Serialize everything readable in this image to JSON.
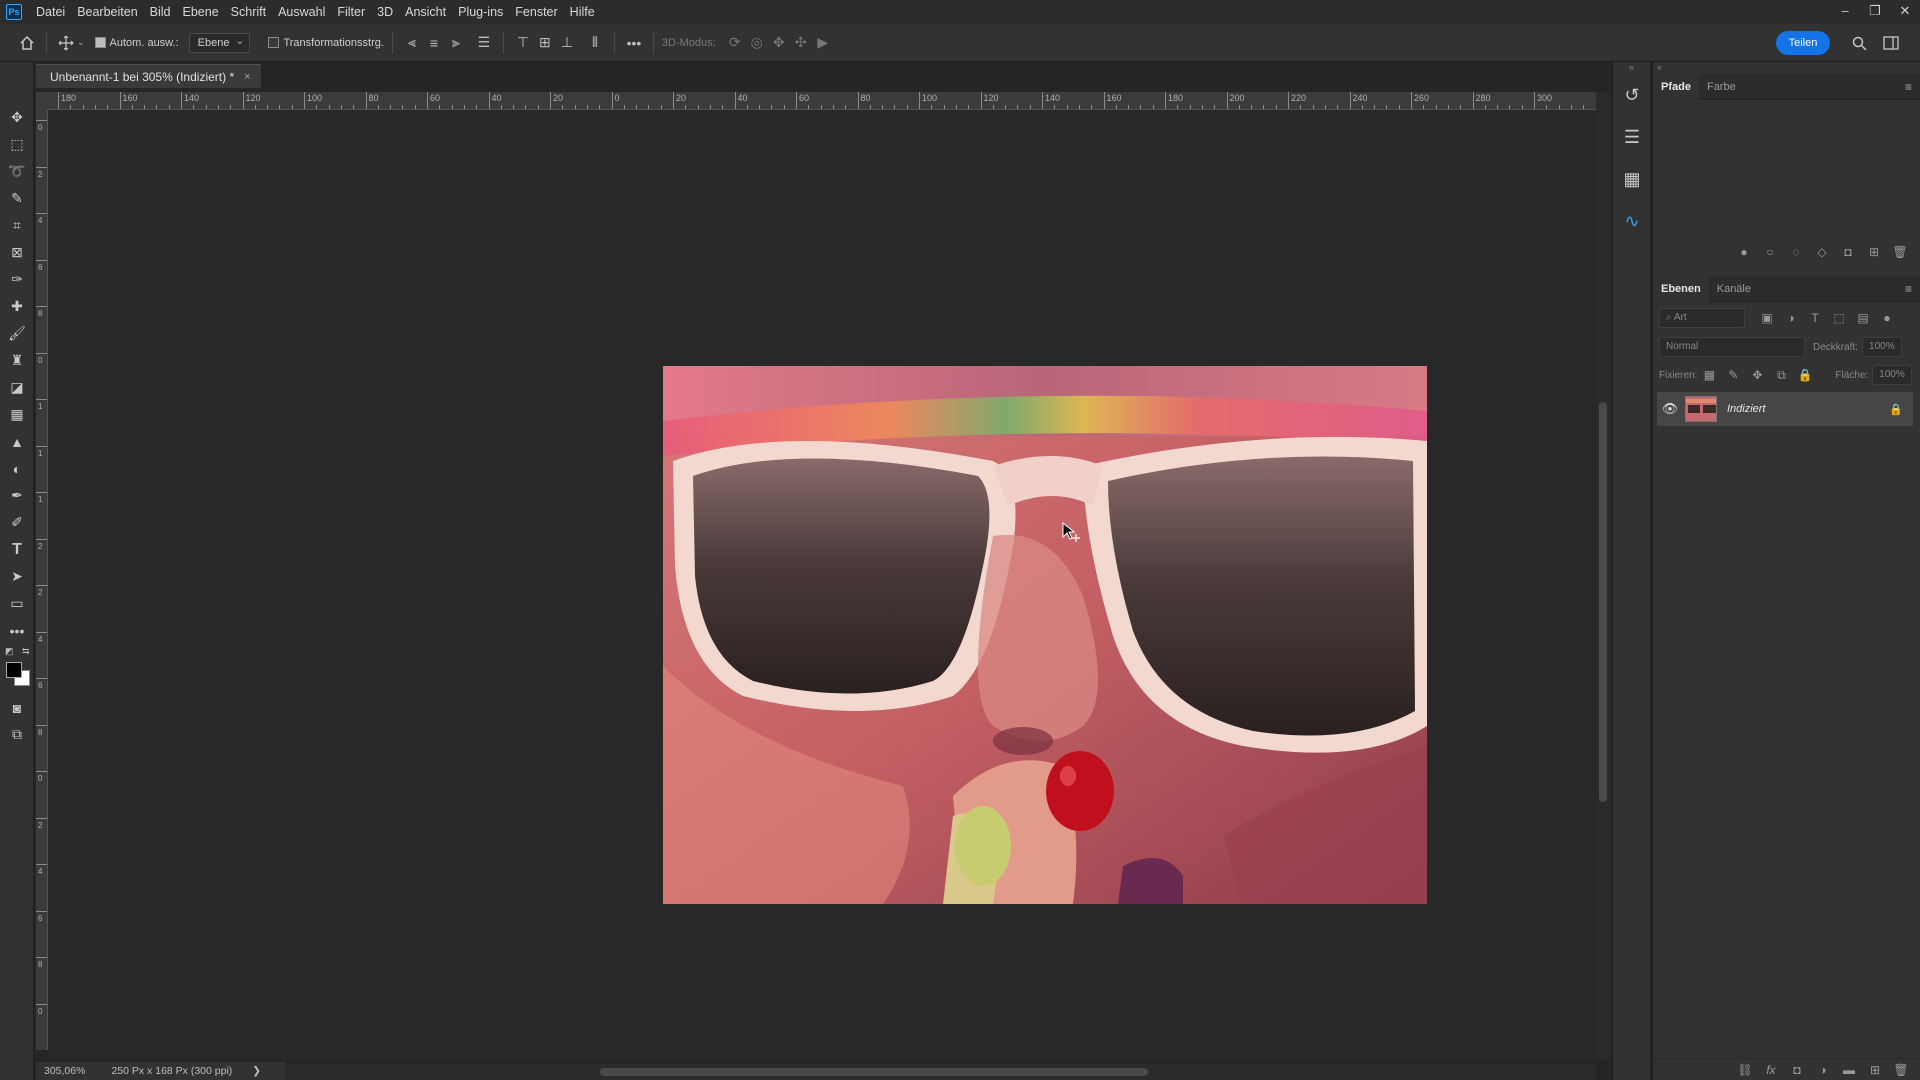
{
  "menubar": {
    "logo": "Ps",
    "items": [
      "Datei",
      "Bearbeiten",
      "Bild",
      "Ebene",
      "Schrift",
      "Auswahl",
      "Filter",
      "3D",
      "Ansicht",
      "Plug-ins",
      "Fenster",
      "Hilfe"
    ]
  },
  "window_controls": {
    "minimize": "–",
    "restore": "❐",
    "close": "✕"
  },
  "options_bar": {
    "auto_select_label": "Autom. ausw.:",
    "auto_select_checked": true,
    "layer_dropdown": "Ebene",
    "transform_controls_label": "Transformationsstrg.",
    "mode_3d_label": "3D-Modus:",
    "share_label": "Teilen"
  },
  "document": {
    "tab_title": "Unbenannt-1 bei 305% (Indiziert) *",
    "close_symbol": "×"
  },
  "rulers": {
    "horizontal_labels": [
      "180",
      "160",
      "140",
      "120",
      "100",
      "80",
      "60",
      "40",
      "20",
      "0",
      "20",
      "40",
      "60",
      "80",
      "100",
      "120",
      "140",
      "160",
      "180",
      "200",
      "220",
      "240",
      "260",
      "280",
      "300"
    ],
    "vertical_labels": [
      "0",
      "2",
      "4",
      "6",
      "8",
      "0",
      "1",
      "1",
      "1",
      "2",
      "2",
      "4",
      "6",
      "8",
      "0",
      "2",
      "4",
      "6",
      "8",
      "0"
    ]
  },
  "status": {
    "zoom": "305,06%",
    "doc_info": "250 Px x 168 Px (300 ppi)",
    "arrow": "❯"
  },
  "paths_panel": {
    "tabs": [
      "Pfade",
      "Farbe"
    ],
    "active_tab": "Pfade"
  },
  "layers_panel": {
    "tabs": [
      "Ebenen",
      "Kanäle"
    ],
    "active_tab": "Ebenen",
    "filter_placeholder": "Art",
    "blend_mode": "Normal",
    "opacity_label": "Deckkraft:",
    "opacity_value": "100%",
    "lock_label": "Fixieren:",
    "fill_label": "Fläche:",
    "fill_value": "100%",
    "layers": [
      {
        "name": "Indiziert",
        "visible": true,
        "locked": true
      }
    ]
  },
  "colors": {
    "accent": "#1473e6",
    "foreground": "#000000",
    "background": "#ffffff"
  }
}
